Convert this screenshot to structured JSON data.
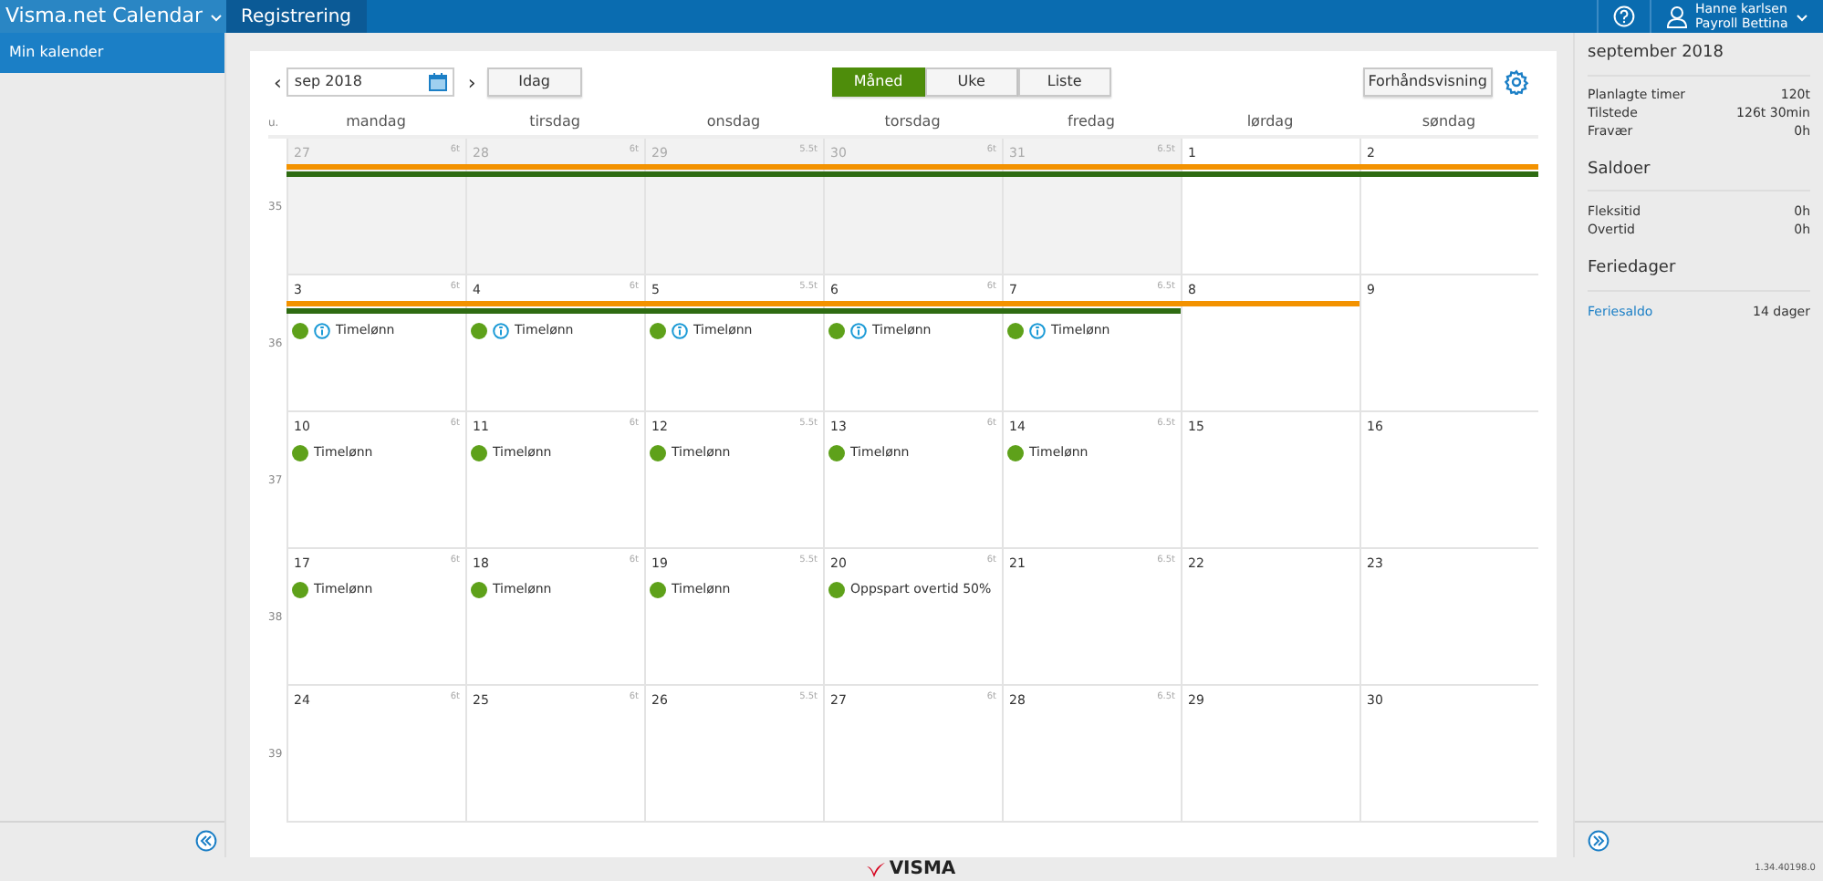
{
  "topbar": {
    "app_title": "Visma.net Calendar",
    "menu": [
      {
        "label": "Registrering",
        "selected": true
      }
    ],
    "user": {
      "name": "Hanne karlsen",
      "company": "Payroll Bettina"
    }
  },
  "sidebar": {
    "items": [
      {
        "label": "Min kalender",
        "selected": true
      }
    ]
  },
  "toolbar": {
    "previous": "‹",
    "next": "›",
    "period": "sep 2018",
    "today": "Idag",
    "views": [
      {
        "label": "Måned",
        "selected": true
      },
      {
        "label": "Uke",
        "selected": false
      },
      {
        "label": "Liste",
        "selected": false
      }
    ],
    "preview": "Forhåndsvisning"
  },
  "calendar": {
    "week_header": "u.",
    "days": [
      "mandag",
      "tirsdag",
      "onsdag",
      "torsdag",
      "fredag",
      "lørdag",
      "søndag"
    ],
    "weeks": [
      {
        "number": "35",
        "days": [
          {
            "date": "27",
            "hours": "6t",
            "outside_month": true,
            "bars": [
              {
                "color": "#f39200"
              },
              {
                "color": "#2e6b12"
              }
            ]
          },
          {
            "date": "28",
            "hours": "6t",
            "outside_month": true,
            "bars": [
              {
                "color": "#f39200"
              },
              {
                "color": "#2e6b12"
              }
            ]
          },
          {
            "date": "29",
            "hours": "5.5t",
            "outside_month": true,
            "bars": [
              {
                "color": "#f39200"
              },
              {
                "color": "#2e6b12"
              }
            ]
          },
          {
            "date": "30",
            "hours": "6t",
            "outside_month": true,
            "bars": [
              {
                "color": "#f39200"
              },
              {
                "color": "#2e6b12"
              }
            ]
          },
          {
            "date": "31",
            "hours": "6.5t",
            "outside_month": true,
            "bars": [
              {
                "color": "#f39200"
              },
              {
                "color": "#2e6b12"
              }
            ]
          },
          {
            "date": "1",
            "outside_month": false,
            "bars": [
              {
                "color": "#f39200"
              },
              {
                "color": "#2e6b12"
              }
            ]
          },
          {
            "date": "2",
            "outside_month": false,
            "bars": [
              {
                "color": "#f39200"
              },
              {
                "color": "#2e6b12"
              }
            ]
          }
        ]
      },
      {
        "number": "36",
        "days": [
          {
            "date": "3",
            "hours": "6t",
            "outside_month": false,
            "bars": [
              {
                "color": "#f39200"
              },
              {
                "color": "#2e6b12"
              }
            ],
            "entries": [
              {
                "label": "Timelønn",
                "info": true
              }
            ]
          },
          {
            "date": "4",
            "hours": "6t",
            "outside_month": false,
            "bars": [
              {
                "color": "#f39200"
              },
              {
                "color": "#2e6b12"
              }
            ],
            "entries": [
              {
                "label": "Timelønn",
                "info": true
              }
            ]
          },
          {
            "date": "5",
            "hours": "5.5t",
            "outside_month": false,
            "bars": [
              {
                "color": "#f39200"
              },
              {
                "color": "#2e6b12"
              }
            ],
            "entries": [
              {
                "label": "Timelønn",
                "info": true
              }
            ]
          },
          {
            "date": "6",
            "hours": "6t",
            "outside_month": false,
            "bars": [
              {
                "color": "#f39200"
              },
              {
                "color": "#2e6b12"
              }
            ],
            "entries": [
              {
                "label": "Timelønn",
                "info": true
              }
            ]
          },
          {
            "date": "7",
            "hours": "6.5t",
            "outside_month": false,
            "bars": [
              {
                "color": "#f39200"
              },
              {
                "color": "#2e6b12"
              }
            ],
            "entries": [
              {
                "label": "Timelønn",
                "info": true
              }
            ]
          },
          {
            "date": "8",
            "outside_month": false,
            "bars": [
              {
                "color": "#f39200"
              }
            ]
          },
          {
            "date": "9",
            "outside_month": false
          }
        ]
      },
      {
        "number": "37",
        "days": [
          {
            "date": "10",
            "hours": "6t",
            "outside_month": false,
            "entries": [
              {
                "label": "Timelønn",
                "info": false
              }
            ]
          },
          {
            "date": "11",
            "hours": "6t",
            "outside_month": false,
            "entries": [
              {
                "label": "Timelønn",
                "info": false
              }
            ]
          },
          {
            "date": "12",
            "hours": "5.5t",
            "outside_month": false,
            "entries": [
              {
                "label": "Timelønn",
                "info": false
              }
            ]
          },
          {
            "date": "13",
            "hours": "6t",
            "outside_month": false,
            "entries": [
              {
                "label": "Timelønn",
                "info": false
              }
            ]
          },
          {
            "date": "14",
            "hours": "6.5t",
            "outside_month": false,
            "entries": [
              {
                "label": "Timelønn",
                "info": false
              }
            ]
          },
          {
            "date": "15",
            "outside_month": false
          },
          {
            "date": "16",
            "outside_month": false
          }
        ]
      },
      {
        "number": "38",
        "days": [
          {
            "date": "17",
            "hours": "6t",
            "outside_month": false,
            "entries": [
              {
                "label": "Timelønn",
                "info": false
              }
            ]
          },
          {
            "date": "18",
            "hours": "6t",
            "outside_month": false,
            "entries": [
              {
                "label": "Timelønn",
                "info": false
              }
            ]
          },
          {
            "date": "19",
            "hours": "5.5t",
            "outside_month": false,
            "entries": [
              {
                "label": "Timelønn",
                "info": false
              }
            ]
          },
          {
            "date": "20",
            "hours": "6t",
            "outside_month": false,
            "entries": [
              {
                "label": "Oppspart overtid 50%",
                "info": false
              }
            ]
          },
          {
            "date": "21",
            "hours": "6.5t",
            "outside_month": false
          },
          {
            "date": "22",
            "outside_month": false
          },
          {
            "date": "23",
            "outside_month": false
          }
        ]
      },
      {
        "number": "39",
        "days": [
          {
            "date": "24",
            "hours": "6t",
            "outside_month": false
          },
          {
            "date": "25",
            "hours": "6t",
            "outside_month": false
          },
          {
            "date": "26",
            "hours": "5.5t",
            "outside_month": false
          },
          {
            "date": "27",
            "hours": "6t",
            "outside_month": false
          },
          {
            "date": "28",
            "hours": "6.5t",
            "outside_month": false
          },
          {
            "date": "29",
            "outside_month": false
          },
          {
            "date": "30",
            "outside_month": false
          }
        ]
      }
    ]
  },
  "summary": {
    "title": "september 2018",
    "sections": [
      {
        "rows": [
          {
            "label": "Planlagte timer",
            "value": "120t",
            "link": false
          },
          {
            "label": "Tilstede",
            "value": "126t 30min",
            "link": false
          },
          {
            "label": "Fravær",
            "value": "0h",
            "link": false
          }
        ]
      },
      {
        "heading": "Saldoer",
        "rows": [
          {
            "label": "Fleksitid",
            "value": "0h",
            "link": false
          },
          {
            "label": "Overtid",
            "value": "0h",
            "link": false
          }
        ]
      },
      {
        "heading": "Feriedager",
        "rows": [
          {
            "label": "Feriesaldo",
            "value": "14 dager",
            "link": true
          }
        ]
      }
    ]
  },
  "footer": {
    "logo": "VISMA",
    "version": "1.34.40198.0"
  }
}
